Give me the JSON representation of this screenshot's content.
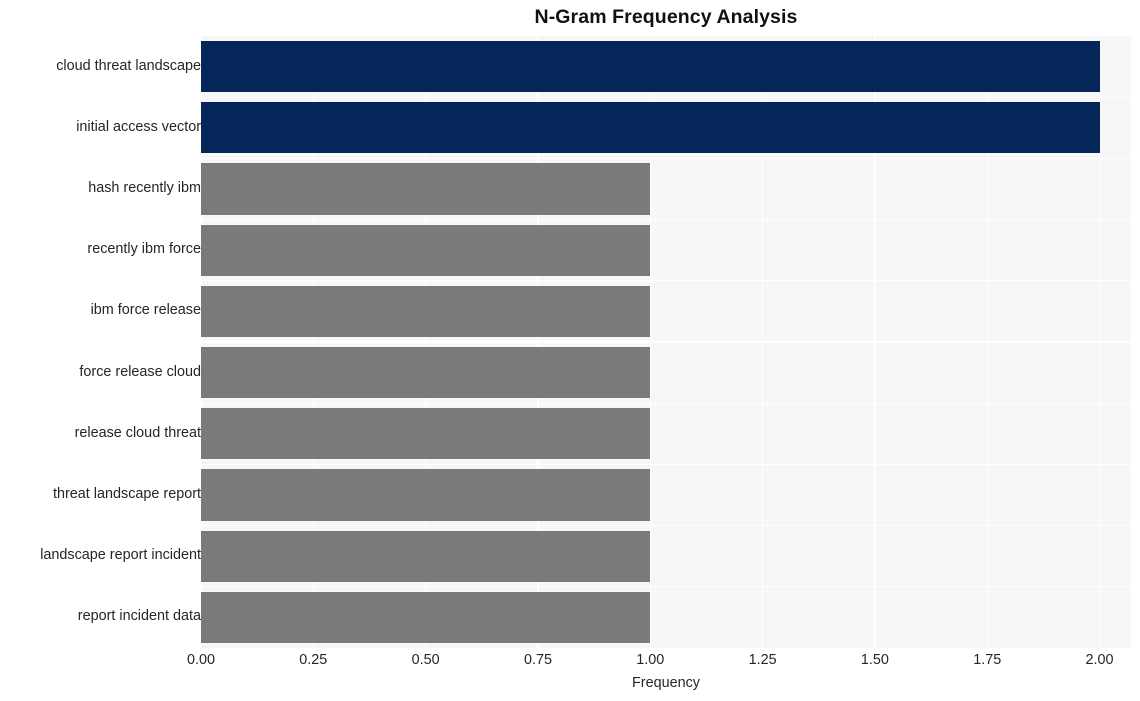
{
  "chart_data": {
    "type": "bar",
    "orientation": "horizontal",
    "title": "N-Gram Frequency Analysis",
    "xlabel": "Frequency",
    "ylabel": "",
    "categories": [
      "cloud threat landscape",
      "initial access vector",
      "hash recently ibm",
      "recently ibm force",
      "ibm force release",
      "force release cloud",
      "release cloud threat",
      "threat landscape report",
      "landscape report incident",
      "report incident data"
    ],
    "values": [
      2,
      2,
      1,
      1,
      1,
      1,
      1,
      1,
      1,
      1
    ],
    "bar_colors": [
      "#06265a",
      "#06265a",
      "#7a7a78",
      "#7a7a78",
      "#7a7a78",
      "#7a7a78",
      "#7a7a78",
      "#7a7a78",
      "#7a7a78",
      "#7a7a78"
    ],
    "xlim": [
      0,
      2.07
    ],
    "xticks": [
      0,
      0.25,
      0.5,
      0.75,
      1,
      1.25,
      1.5,
      1.75,
      2
    ],
    "xtick_labels": [
      "0.00",
      "0.25",
      "0.50",
      "0.75",
      "1.00",
      "1.25",
      "1.50",
      "1.75",
      "2.00"
    ],
    "grid": true,
    "grid_color": "#ffffff",
    "plot_background": "#f7f7f7",
    "figure_background": "#ffffff",
    "legend": null,
    "highlight_color": "#06265a",
    "default_color": "#7a7a78"
  }
}
